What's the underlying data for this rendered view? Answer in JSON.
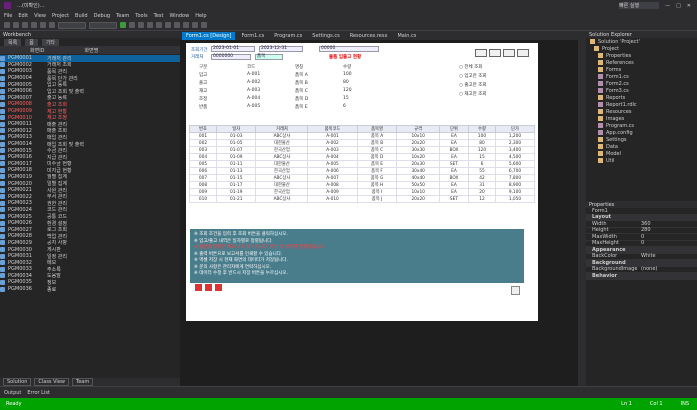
{
  "titlebar": {
    "title": "…(미확인)…",
    "quick_launch": "빠른 실행"
  },
  "menu": [
    "File",
    "Edit",
    "View",
    "Project",
    "Build",
    "Debug",
    "Team",
    "Tools",
    "Test",
    "Window",
    "Help"
  ],
  "left_panel": {
    "title": "Workbench",
    "tabs": [
      "목록",
      "폼",
      "기타"
    ],
    "header": [
      "화면ID",
      "화면명"
    ],
    "rows": [
      {
        "k": "PGM0001",
        "v": "거래처 관리"
      },
      {
        "k": "PGM0002",
        "v": "거래처 조회"
      },
      {
        "k": "PGM0003",
        "v": "품목 관리"
      },
      {
        "k": "PGM0004",
        "v": "품목 단가 관리"
      },
      {
        "k": "PGM0005",
        "v": "입고 등록"
      },
      {
        "k": "PGM0006",
        "v": "입고 조회 및 출력"
      },
      {
        "k": "PGM0007",
        "v": "출고 등록"
      },
      {
        "k": "PGM0008",
        "v": "출고 조회"
      },
      {
        "k": "PGM0009",
        "v": "재고 현황"
      },
      {
        "k": "PGM0010",
        "v": "재고 조정"
      },
      {
        "k": "PGM0011",
        "v": "매출 관리"
      },
      {
        "k": "PGM0012",
        "v": "매출 조회"
      },
      {
        "k": "PGM0013",
        "v": "매입 관리"
      },
      {
        "k": "PGM0014",
        "v": "매입 조회 및 출력"
      },
      {
        "k": "PGM0015",
        "v": "수금 관리"
      },
      {
        "k": "PGM0016",
        "v": "지급 관리"
      },
      {
        "k": "PGM0017",
        "v": "미수금 현황"
      },
      {
        "k": "PGM0018",
        "v": "미지급 현황"
      },
      {
        "k": "PGM0019",
        "v": "월별 집계"
      },
      {
        "k": "PGM0020",
        "v": "일별 집계"
      },
      {
        "k": "PGM0021",
        "v": "사원 관리"
      },
      {
        "k": "PGM0022",
        "v": "부서 관리"
      },
      {
        "k": "PGM0023",
        "v": "권한 관리"
      },
      {
        "k": "PGM0024",
        "v": "코드 관리"
      },
      {
        "k": "PGM0025",
        "v": "공통 코드"
      },
      {
        "k": "PGM0026",
        "v": "환경 설정"
      },
      {
        "k": "PGM0027",
        "v": "로그 조회"
      },
      {
        "k": "PGM0028",
        "v": "백업 관리"
      },
      {
        "k": "PGM0029",
        "v": "공지 사항"
      },
      {
        "k": "PGM0030",
        "v": "게시판"
      },
      {
        "k": "PGM0031",
        "v": "일정 관리"
      },
      {
        "k": "PGM0032",
        "v": "메모"
      },
      {
        "k": "PGM0033",
        "v": "주소록"
      },
      {
        "k": "PGM0034",
        "v": "도움말"
      },
      {
        "k": "PGM0035",
        "v": "정보"
      },
      {
        "k": "PGM0036",
        "v": "종료"
      }
    ],
    "bottom_tabs": [
      "Solution",
      "Class View",
      "Team"
    ]
  },
  "doc_tabs": [
    "Form1.cs [Design]",
    "Form1.cs",
    "Program.cs",
    "Settings.cs",
    "Resources.resx",
    "Main.cs"
  ],
  "form": {
    "title_label": "물품 입출고 현황",
    "top_labels": [
      "조회기간",
      "거래처",
      "품목"
    ],
    "fields": [
      "2023-01-01",
      "2023-12-31",
      "0000000",
      "00000"
    ],
    "info_rows": [
      [
        "구분",
        "코드",
        "명칭",
        "수량"
      ],
      [
        "입고",
        "A-001",
        "품목 A",
        "100"
      ],
      [
        "출고",
        "A-002",
        "품목 B",
        "80"
      ],
      [
        "재고",
        "A-003",
        "품목 C",
        "120"
      ],
      [
        "조정",
        "A-004",
        "품목 D",
        "15"
      ],
      [
        "반품",
        "A-005",
        "품목 E",
        "6"
      ]
    ],
    "side_options": [
      "전체 조회",
      "입고만 조회",
      "출고만 조회",
      "재고만 조회"
    ],
    "grid_headers": [
      "번호",
      "일자",
      "거래처",
      "품목코드",
      "품목명",
      "규격",
      "단위",
      "수량",
      "단가"
    ],
    "grid_rows": [
      [
        "001",
        "01-03",
        "ABC상사",
        "A-001",
        "품목 A",
        "10x10",
        "EA",
        "100",
        "1,200"
      ],
      [
        "002",
        "01-05",
        "대한물산",
        "A-002",
        "품목 B",
        "20x20",
        "EA",
        "80",
        "2,300"
      ],
      [
        "003",
        "01-07",
        "한국산업",
        "A-003",
        "품목 C",
        "30x30",
        "BOX",
        "120",
        "3,400"
      ],
      [
        "004",
        "01-09",
        "ABC상사",
        "A-004",
        "품목 D",
        "10x20",
        "EA",
        "15",
        "4,500"
      ],
      [
        "005",
        "01-11",
        "대한물산",
        "A-005",
        "품목 E",
        "20x30",
        "SET",
        "6",
        "5,600"
      ],
      [
        "006",
        "01-13",
        "한국산업",
        "A-006",
        "품목 F",
        "30x40",
        "EA",
        "55",
        "6,700"
      ],
      [
        "007",
        "01-15",
        "ABC상사",
        "A-007",
        "품목 G",
        "40x40",
        "BOX",
        "42",
        "7,800"
      ],
      [
        "008",
        "01-17",
        "대한물산",
        "A-008",
        "품목 H",
        "50x50",
        "EA",
        "31",
        "8,900"
      ],
      [
        "009",
        "01-19",
        "한국산업",
        "A-009",
        "품목 I",
        "10x10",
        "EA",
        "20",
        "9,100"
      ],
      [
        "010",
        "01-21",
        "ABC상사",
        "A-010",
        "품목 J",
        "20x20",
        "SET",
        "12",
        "1,050"
      ]
    ],
    "notes": [
      "※ 조회 조건을 입력 후 조회 버튼을 클릭하십시오.",
      "※ 입고/출고 내역은 일자별로 정렬됩니다.",
      "※ 빨간색 항목은 재고 부족 품목입니다. 확인 후 발주를 진행하십시오.",
      "※ 출력 버튼으로 보고서를 인쇄할 수 있습니다.",
      "※ 엑셀 저장 시 현재 화면의 데이터가 저장됩니다.",
      "※ 문의 사항은 관리자에게 연락하십시오.",
      "※ 데이터 수정 후 반드시 저장 버튼을 누르십시오."
    ]
  },
  "solution": {
    "title": "Solution Explorer",
    "items": [
      "Solution 'Project'",
      "Project",
      "Properties",
      "References",
      "Forms",
      "Form1.cs",
      "Form2.cs",
      "Form3.cs",
      "Reports",
      "Report1.rdlc",
      "Resources",
      "Images",
      "Program.cs",
      "App.config",
      "Settings",
      "Data",
      "Model",
      "Util"
    ]
  },
  "properties": {
    "title": "Properties",
    "object": "Form1",
    "rows": [
      {
        "cat": true,
        "n": "Layout",
        "v": ""
      },
      {
        "n": "Width",
        "v": "360"
      },
      {
        "n": "Height",
        "v": "280"
      },
      {
        "n": "MaxWidth",
        "v": "0"
      },
      {
        "n": "MaxHeight",
        "v": "0"
      },
      {
        "cat": true,
        "n": "Appearance",
        "v": ""
      },
      {
        "n": "BackColor",
        "v": "White"
      },
      {
        "cat": true,
        "n": "Background",
        "v": ""
      },
      {
        "n": "BackgroundImage",
        "v": "(none)"
      },
      {
        "cat": true,
        "n": "Behavior",
        "v": ""
      }
    ]
  },
  "output_tabs": [
    "Output",
    "Error List"
  ],
  "status": {
    "left": "Ready",
    "ln": "Ln 1",
    "col": "Col 1",
    "ins": "INS"
  }
}
